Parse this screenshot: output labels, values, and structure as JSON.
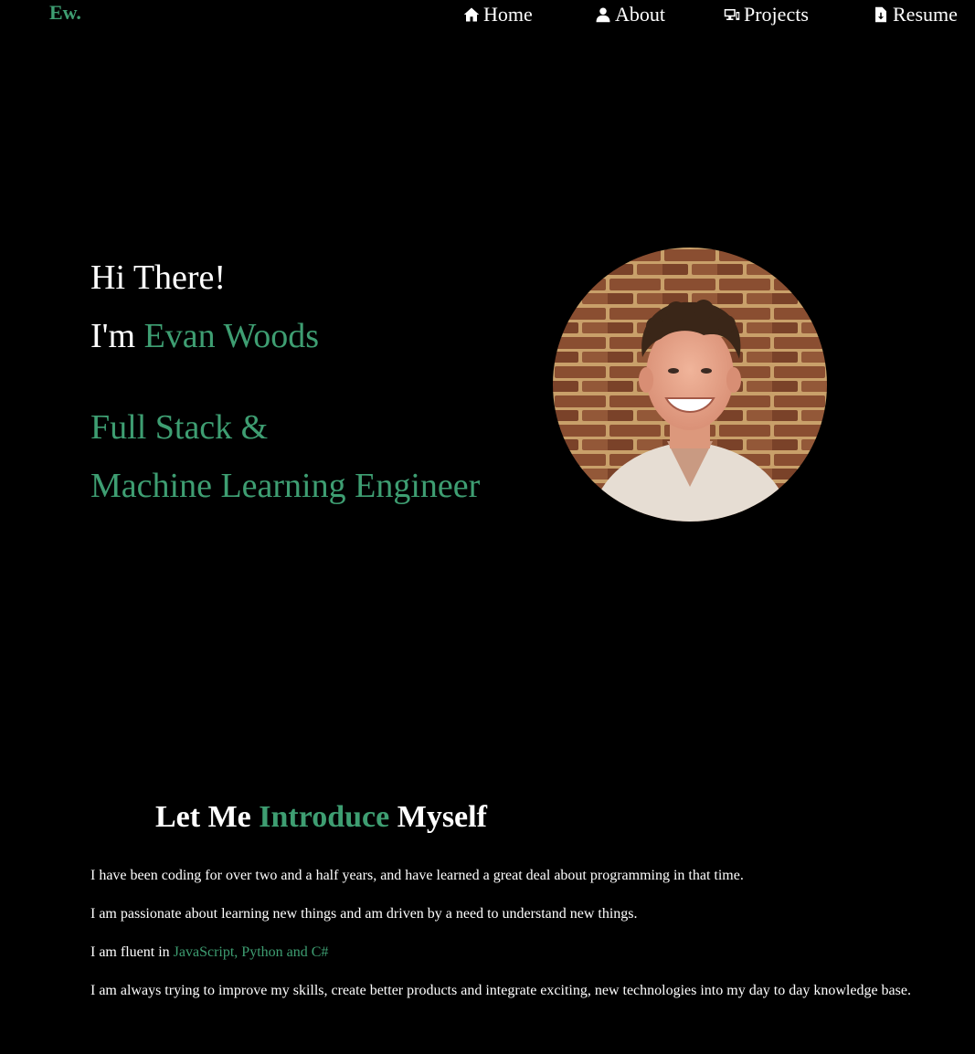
{
  "nav": {
    "brand": "Ew.",
    "items": [
      {
        "label": "Home",
        "icon": "home-icon"
      },
      {
        "label": "About",
        "icon": "user-icon"
      },
      {
        "label": "Projects",
        "icon": "devices-icon"
      },
      {
        "label": "Resume",
        "icon": "file-download-icon"
      }
    ]
  },
  "hero": {
    "greeting": "Hi There!",
    "im_prefix": "I'm ",
    "name": "Evan Woods",
    "role_line1": "Full Stack &",
    "role_line2": "Machine Learning Engineer",
    "avatar_alt": "profile photo"
  },
  "intro": {
    "title_part1": "Let Me ",
    "title_accent": "Introduce",
    "title_part2": " Myself",
    "p1": "I have been coding for over two and a half years, and have learned a great deal about programming in that time.",
    "p2": "I am passionate about learning new things and am driven by a need to understand new things.",
    "p3_prefix": "I am fluent in ",
    "p3_langs": "JavaScript, Python and C#",
    "p4": "I am always trying to improve my skills, create better products and integrate exciting, new technologies into my day to day knowledge base."
  },
  "colors": {
    "accent": "#3e9e72",
    "background": "#000000",
    "text": "#ffffff"
  }
}
